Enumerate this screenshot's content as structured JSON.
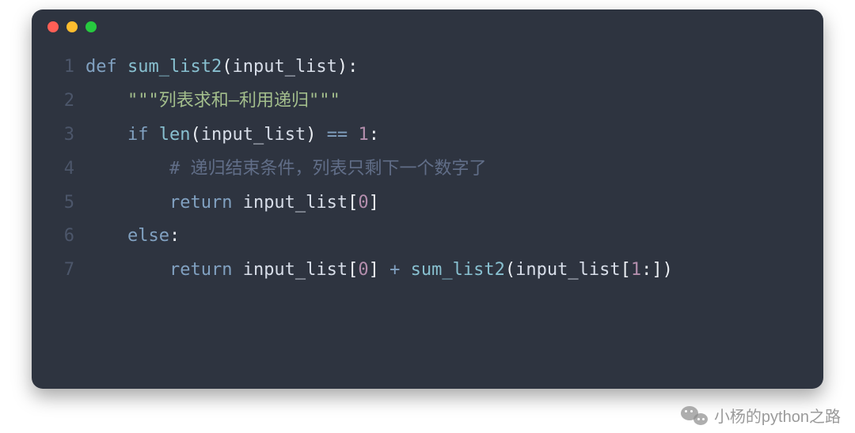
{
  "window": {
    "dots": [
      "#ff5f56",
      "#ffbd2e",
      "#27c93f"
    ]
  },
  "code": {
    "lines": [
      {
        "n": "1",
        "tokens": [
          {
            "c": "tok-kw",
            "t": "def"
          },
          {
            "c": "tok-id",
            "t": " "
          },
          {
            "c": "tok-fn",
            "t": "sum_list2"
          },
          {
            "c": "tok-punc",
            "t": "("
          },
          {
            "c": "tok-id",
            "t": "input_list"
          },
          {
            "c": "tok-punc",
            "t": ")"
          },
          {
            "c": "tok-punc",
            "t": ":"
          }
        ]
      },
      {
        "n": "2",
        "tokens": [
          {
            "c": "tok-id",
            "t": "    "
          },
          {
            "c": "tok-str",
            "t": "\"\"\"列表求和—利用递归\"\"\""
          }
        ]
      },
      {
        "n": "3",
        "tokens": [
          {
            "c": "tok-id",
            "t": "    "
          },
          {
            "c": "tok-kw",
            "t": "if"
          },
          {
            "c": "tok-id",
            "t": " "
          },
          {
            "c": "tok-bi",
            "t": "len"
          },
          {
            "c": "tok-punc",
            "t": "("
          },
          {
            "c": "tok-id",
            "t": "input_list"
          },
          {
            "c": "tok-punc",
            "t": ")"
          },
          {
            "c": "tok-id",
            "t": " "
          },
          {
            "c": "tok-op",
            "t": "=="
          },
          {
            "c": "tok-id",
            "t": " "
          },
          {
            "c": "tok-num",
            "t": "1"
          },
          {
            "c": "tok-punc",
            "t": ":"
          }
        ]
      },
      {
        "n": "4",
        "tokens": [
          {
            "c": "tok-id",
            "t": "        "
          },
          {
            "c": "tok-com",
            "t": "# 递归结束条件，列表只剩下一个数字了"
          }
        ]
      },
      {
        "n": "5",
        "tokens": [
          {
            "c": "tok-id",
            "t": "        "
          },
          {
            "c": "tok-kw",
            "t": "return"
          },
          {
            "c": "tok-id",
            "t": " input_list"
          },
          {
            "c": "tok-punc",
            "t": "["
          },
          {
            "c": "tok-num",
            "t": "0"
          },
          {
            "c": "tok-punc",
            "t": "]"
          }
        ]
      },
      {
        "n": "6",
        "tokens": [
          {
            "c": "tok-id",
            "t": "    "
          },
          {
            "c": "tok-kw",
            "t": "else"
          },
          {
            "c": "tok-punc",
            "t": ":"
          }
        ]
      },
      {
        "n": "7",
        "tokens": [
          {
            "c": "tok-id",
            "t": "        "
          },
          {
            "c": "tok-kw",
            "t": "return"
          },
          {
            "c": "tok-id",
            "t": " input_list"
          },
          {
            "c": "tok-punc",
            "t": "["
          },
          {
            "c": "tok-num",
            "t": "0"
          },
          {
            "c": "tok-punc",
            "t": "]"
          },
          {
            "c": "tok-id",
            "t": " "
          },
          {
            "c": "tok-op",
            "t": "+"
          },
          {
            "c": "tok-id",
            "t": " "
          },
          {
            "c": "tok-fn",
            "t": "sum_list2"
          },
          {
            "c": "tok-punc",
            "t": "("
          },
          {
            "c": "tok-id",
            "t": "input_list"
          },
          {
            "c": "tok-punc",
            "t": "["
          },
          {
            "c": "tok-num",
            "t": "1"
          },
          {
            "c": "tok-punc",
            "t": ":"
          },
          {
            "c": "tok-punc",
            "t": "]"
          },
          {
            "c": "tok-punc",
            "t": ")"
          }
        ]
      }
    ]
  },
  "watermark": {
    "text": "小杨的python之路"
  }
}
